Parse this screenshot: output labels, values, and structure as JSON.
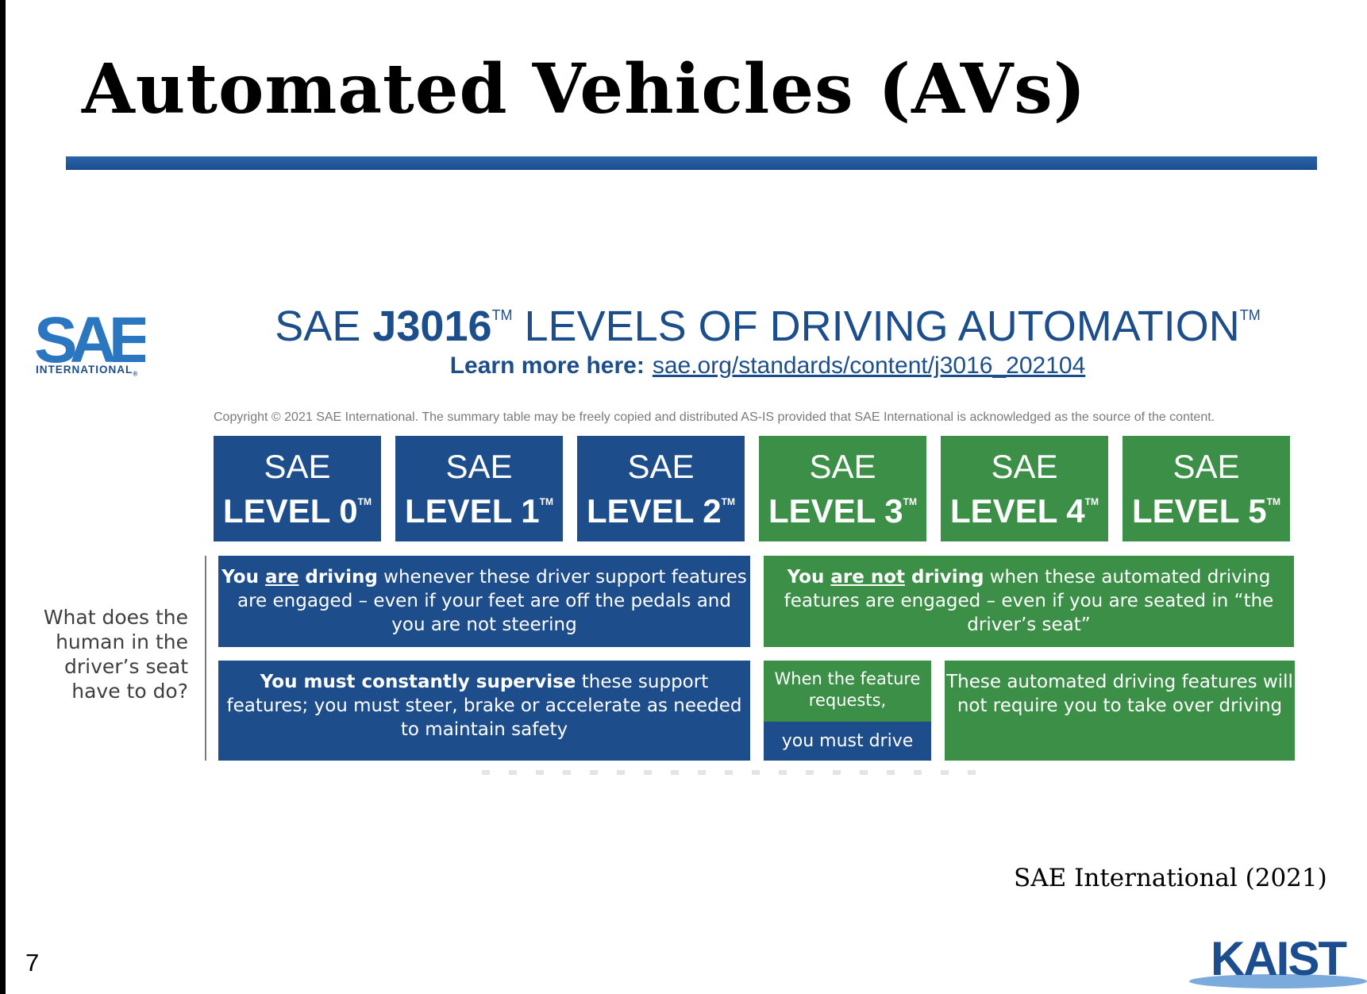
{
  "slide": {
    "title": "Automated Vehicles (AVs)",
    "citation": "SAE International (2021)",
    "page_number": "7"
  },
  "sae_logo": {
    "name": "sae-logo",
    "subtitle": "INTERNATIONAL",
    "registered_mark": "®"
  },
  "header": {
    "prefix": "SAE ",
    "standard": "J3016",
    "tm1": "TM",
    "main": " LEVELS OF DRIVING AUTOMATION",
    "tm2": "TM",
    "learn_more_label": "Learn more here:",
    "learn_more_link": "sae.org/standards/content/j3016_202104"
  },
  "copyright": "Copyright © 2021 SAE International. The summary table may be freely copied and distributed AS-IS provided that SAE International is acknowledged as the source of the content.",
  "levels": [
    {
      "sae": "SAE",
      "level": "LEVEL 0",
      "tm": "TM"
    },
    {
      "sae": "SAE",
      "level": "LEVEL 1",
      "tm": "TM"
    },
    {
      "sae": "SAE",
      "level": "LEVEL 2",
      "tm": "TM"
    },
    {
      "sae": "SAE",
      "level": "LEVEL 3",
      "tm": "TM"
    },
    {
      "sae": "SAE",
      "level": "LEVEL 4",
      "tm": "TM"
    },
    {
      "sae": "SAE",
      "level": "LEVEL 5",
      "tm": "TM"
    }
  ],
  "question": "What does the human in the driver’s seat have to do?",
  "cells": {
    "driving": {
      "you": "You ",
      "are": "are",
      "driving": " driving",
      "rest": " whenever these driver support features are engaged – even if your feet are off the pedals and you are not steering"
    },
    "not_driving": {
      "you": "You ",
      "are_not": "are not",
      "driving": " driving",
      "rest": " when these automated driving features are engaged – even if you are seated in “the driver’s seat”"
    },
    "supervise": {
      "bold": "You must constantly supervise",
      "rest": " these support features; you must steer, brake or accelerate as needed to maintain safety"
    },
    "feature_request": {
      "top": "When the feature requests,",
      "bottom": "you must drive"
    },
    "no_takeover": "These automated driving features will not require you to take over driving"
  },
  "kaist_logo": {
    "name": "kaist-logo",
    "text": "KAIST"
  },
  "colors": {
    "blue": "#1d4d8b",
    "green": "#3c8f47",
    "title_rule": "#2c64a8"
  }
}
